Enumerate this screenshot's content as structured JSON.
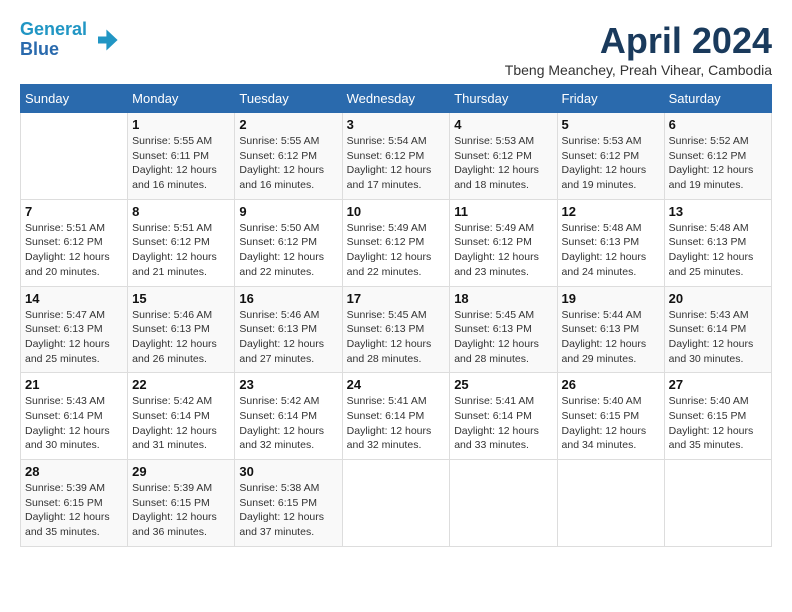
{
  "header": {
    "logo_line1": "General",
    "logo_line2": "Blue",
    "month_title": "April 2024",
    "location": "Tbeng Meanchey, Preah Vihear, Cambodia"
  },
  "days_of_week": [
    "Sunday",
    "Monday",
    "Tuesday",
    "Wednesday",
    "Thursday",
    "Friday",
    "Saturday"
  ],
  "weeks": [
    [
      {
        "day": "",
        "info": ""
      },
      {
        "day": "1",
        "info": "Sunrise: 5:55 AM\nSunset: 6:11 PM\nDaylight: 12 hours\nand 16 minutes."
      },
      {
        "day": "2",
        "info": "Sunrise: 5:55 AM\nSunset: 6:12 PM\nDaylight: 12 hours\nand 16 minutes."
      },
      {
        "day": "3",
        "info": "Sunrise: 5:54 AM\nSunset: 6:12 PM\nDaylight: 12 hours\nand 17 minutes."
      },
      {
        "day": "4",
        "info": "Sunrise: 5:53 AM\nSunset: 6:12 PM\nDaylight: 12 hours\nand 18 minutes."
      },
      {
        "day": "5",
        "info": "Sunrise: 5:53 AM\nSunset: 6:12 PM\nDaylight: 12 hours\nand 19 minutes."
      },
      {
        "day": "6",
        "info": "Sunrise: 5:52 AM\nSunset: 6:12 PM\nDaylight: 12 hours\nand 19 minutes."
      }
    ],
    [
      {
        "day": "7",
        "info": "Sunrise: 5:51 AM\nSunset: 6:12 PM\nDaylight: 12 hours\nand 20 minutes."
      },
      {
        "day": "8",
        "info": "Sunrise: 5:51 AM\nSunset: 6:12 PM\nDaylight: 12 hours\nand 21 minutes."
      },
      {
        "day": "9",
        "info": "Sunrise: 5:50 AM\nSunset: 6:12 PM\nDaylight: 12 hours\nand 22 minutes."
      },
      {
        "day": "10",
        "info": "Sunrise: 5:49 AM\nSunset: 6:12 PM\nDaylight: 12 hours\nand 22 minutes."
      },
      {
        "day": "11",
        "info": "Sunrise: 5:49 AM\nSunset: 6:12 PM\nDaylight: 12 hours\nand 23 minutes."
      },
      {
        "day": "12",
        "info": "Sunrise: 5:48 AM\nSunset: 6:13 PM\nDaylight: 12 hours\nand 24 minutes."
      },
      {
        "day": "13",
        "info": "Sunrise: 5:48 AM\nSunset: 6:13 PM\nDaylight: 12 hours\nand 25 minutes."
      }
    ],
    [
      {
        "day": "14",
        "info": "Sunrise: 5:47 AM\nSunset: 6:13 PM\nDaylight: 12 hours\nand 25 minutes."
      },
      {
        "day": "15",
        "info": "Sunrise: 5:46 AM\nSunset: 6:13 PM\nDaylight: 12 hours\nand 26 minutes."
      },
      {
        "day": "16",
        "info": "Sunrise: 5:46 AM\nSunset: 6:13 PM\nDaylight: 12 hours\nand 27 minutes."
      },
      {
        "day": "17",
        "info": "Sunrise: 5:45 AM\nSunset: 6:13 PM\nDaylight: 12 hours\nand 28 minutes."
      },
      {
        "day": "18",
        "info": "Sunrise: 5:45 AM\nSunset: 6:13 PM\nDaylight: 12 hours\nand 28 minutes."
      },
      {
        "day": "19",
        "info": "Sunrise: 5:44 AM\nSunset: 6:13 PM\nDaylight: 12 hours\nand 29 minutes."
      },
      {
        "day": "20",
        "info": "Sunrise: 5:43 AM\nSunset: 6:14 PM\nDaylight: 12 hours\nand 30 minutes."
      }
    ],
    [
      {
        "day": "21",
        "info": "Sunrise: 5:43 AM\nSunset: 6:14 PM\nDaylight: 12 hours\nand 30 minutes."
      },
      {
        "day": "22",
        "info": "Sunrise: 5:42 AM\nSunset: 6:14 PM\nDaylight: 12 hours\nand 31 minutes."
      },
      {
        "day": "23",
        "info": "Sunrise: 5:42 AM\nSunset: 6:14 PM\nDaylight: 12 hours\nand 32 minutes."
      },
      {
        "day": "24",
        "info": "Sunrise: 5:41 AM\nSunset: 6:14 PM\nDaylight: 12 hours\nand 32 minutes."
      },
      {
        "day": "25",
        "info": "Sunrise: 5:41 AM\nSunset: 6:14 PM\nDaylight: 12 hours\nand 33 minutes."
      },
      {
        "day": "26",
        "info": "Sunrise: 5:40 AM\nSunset: 6:15 PM\nDaylight: 12 hours\nand 34 minutes."
      },
      {
        "day": "27",
        "info": "Sunrise: 5:40 AM\nSunset: 6:15 PM\nDaylight: 12 hours\nand 35 minutes."
      }
    ],
    [
      {
        "day": "28",
        "info": "Sunrise: 5:39 AM\nSunset: 6:15 PM\nDaylight: 12 hours\nand 35 minutes."
      },
      {
        "day": "29",
        "info": "Sunrise: 5:39 AM\nSunset: 6:15 PM\nDaylight: 12 hours\nand 36 minutes."
      },
      {
        "day": "30",
        "info": "Sunrise: 5:38 AM\nSunset: 6:15 PM\nDaylight: 12 hours\nand 37 minutes."
      },
      {
        "day": "",
        "info": ""
      },
      {
        "day": "",
        "info": ""
      },
      {
        "day": "",
        "info": ""
      },
      {
        "day": "",
        "info": ""
      }
    ]
  ]
}
